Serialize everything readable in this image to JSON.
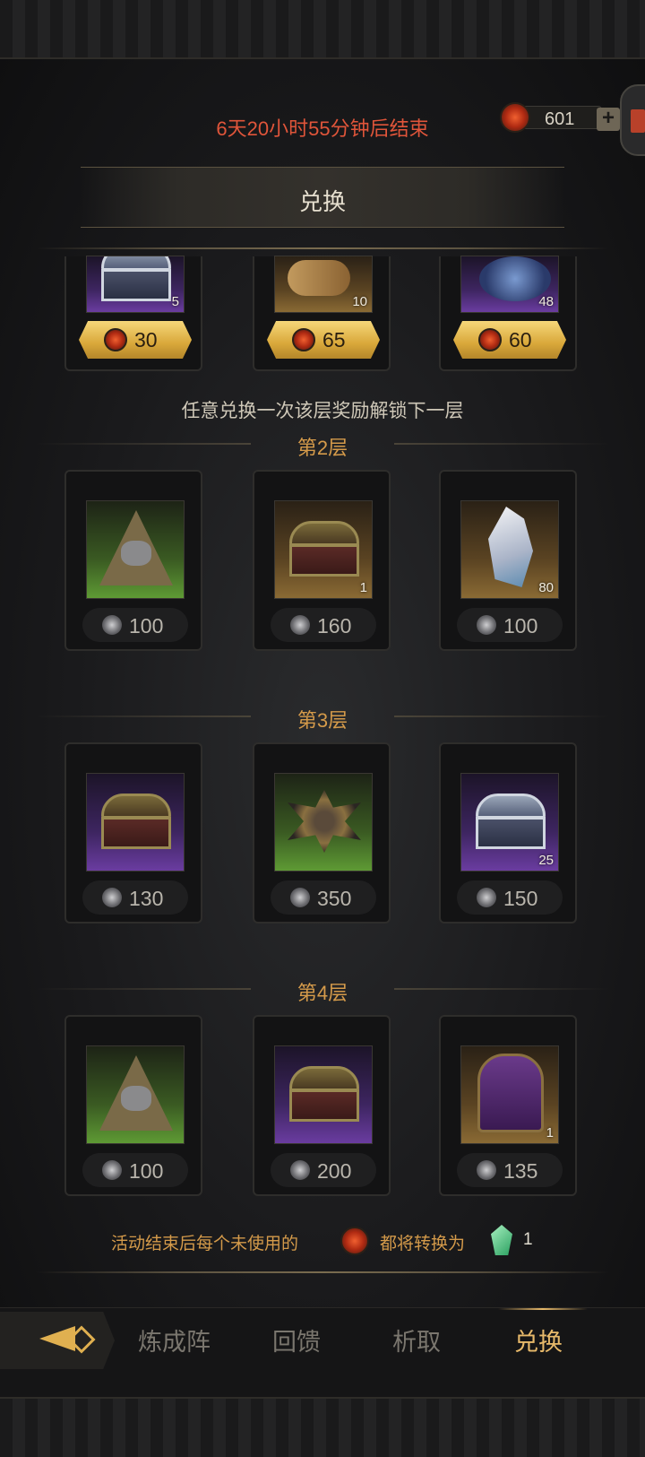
{
  "header": {
    "timer": "6天20小时55分钟后结束",
    "currency_value": "601",
    "add_symbol": "+",
    "title": "兑换"
  },
  "top_row": [
    {
      "qty": "5",
      "price": "30"
    },
    {
      "qty": "10",
      "price": "65"
    },
    {
      "qty": "48",
      "price": "60"
    }
  ],
  "unlock_tip": "任意兑换一次该层奖励解锁下一层",
  "floors": [
    {
      "label": "第2层",
      "items": [
        {
          "qty": "",
          "price": "100"
        },
        {
          "qty": "1",
          "price": "160"
        },
        {
          "qty": "80",
          "price": "100"
        }
      ]
    },
    {
      "label": "第3层",
      "items": [
        {
          "qty": "",
          "price": "130"
        },
        {
          "qty": "",
          "price": "350"
        },
        {
          "qty": "25",
          "price": "150"
        }
      ]
    },
    {
      "label": "第4层",
      "items": [
        {
          "qty": "",
          "price": "100"
        },
        {
          "qty": "",
          "price": "200"
        },
        {
          "qty": "1",
          "price": "135"
        }
      ]
    }
  ],
  "end_tip": {
    "part1": "活动结束后每个未使用的",
    "part2": "都将转换为",
    "amount": "1"
  },
  "tabs": [
    "炼成阵",
    "回馈",
    "析取",
    "兑换"
  ],
  "colors": {
    "accent": "#e7b96a",
    "timer": "#e0553a",
    "floor_label": "#d49a4a"
  }
}
